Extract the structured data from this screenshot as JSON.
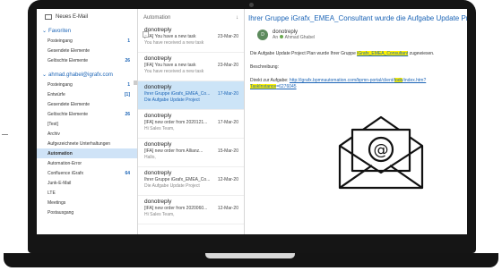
{
  "folders": {
    "new_mail": "Neues E-Mail",
    "favorites_label": "Favoriten",
    "favorites": [
      {
        "label": "Posteingang",
        "count": "1"
      },
      {
        "label": "Gesendete Elemente",
        "count": ""
      },
      {
        "label": "Gelöschte Elemente",
        "count": "26"
      }
    ],
    "account": "ahmad.ghabel@igrafx.com",
    "account_items": [
      {
        "label": "Posteingang",
        "count": "1",
        "selected": false
      },
      {
        "label": "Entwürfe",
        "count": "[1]",
        "selected": false
      },
      {
        "label": "Gesendete Elemente",
        "count": "",
        "selected": false
      },
      {
        "label": "Gelöschte Elemente",
        "count": "26",
        "selected": false
      },
      {
        "label": "[Test]",
        "count": "",
        "selected": false
      },
      {
        "label": "Archiv",
        "count": "",
        "selected": false
      },
      {
        "label": "Aufgezeichnete Unterhaltungen",
        "count": "",
        "selected": false
      },
      {
        "label": "Automation",
        "count": "",
        "selected": true
      },
      {
        "label": "Automation-Error",
        "count": "",
        "selected": false
      },
      {
        "label": "Confluence iGrafx",
        "count": "64",
        "selected": false
      },
      {
        "label": "Junk-E-Mail",
        "count": "",
        "selected": false
      },
      {
        "label": "LTE",
        "count": "",
        "selected": false
      },
      {
        "label": "Meetings",
        "count": "",
        "selected": false
      },
      {
        "label": "Postausgang",
        "count": "",
        "selected": false
      }
    ]
  },
  "msglist": {
    "title": "Automation",
    "sort": "↓",
    "messages": [
      {
        "from": "donotreply",
        "subject": "[IFA] You have a new task",
        "date": "23-Mar-20",
        "preview": "You have received a new task",
        "selected": false
      },
      {
        "from": "donotreply",
        "subject": "[IFA] You have a new task",
        "date": "23-Mar-20",
        "preview": "You have received a new task",
        "selected": false
      },
      {
        "from": "donotreply",
        "subject": "Ihrer Gruppe iGrafx_EMEA_Co...",
        "date": "17-Mar-20",
        "preview": "Die Aufgabe Update Project",
        "selected": true
      },
      {
        "from": "donotreply",
        "subject": "[IFA] new order from 2020121...",
        "date": "17-Mar-20",
        "preview": "Hi Sales Team,",
        "selected": false
      },
      {
        "from": "donotreply",
        "subject": "[IFA] new order from Allianz...",
        "date": "15-Mar-20",
        "preview": "Hallo,",
        "selected": false
      },
      {
        "from": "donotreply",
        "subject": "Ihrer Gruppe iGrafx_EMEA_Co...",
        "date": "12-Mar-20",
        "preview": "Die Aufgabe Update Project",
        "selected": false
      },
      {
        "from": "donotreply",
        "subject": "[IFA] new order from 2020060...",
        "date": "12-Mar-20",
        "preview": "Hi Sales Team,",
        "selected": false
      }
    ]
  },
  "reading": {
    "subject": "Ihrer Gruppe iGrafx_EMEA_Consultant wurde die Aufgabe Update Project Plan im Prozess",
    "avatar_initial": "D",
    "sender": "donotreply",
    "to_prefix": "An",
    "to": "Ahmad Ghabel",
    "body_line1_a": "Die Aufgabe Update Project Plan wurde Ihrer Gruppe ",
    "body_line1_hl": "iGrafx_EMEA_Consultant",
    "body_line1_b": " zugewiesen.",
    "beschreibung": "Beschreibung:",
    "direkt_label": "Direkt zur Aufgabe: ",
    "link_a": "http://igrafx.bpmnautomation.com/bpmn-portal/client/",
    "link_hl1": "todo",
    "link_b": "/index.htm?",
    "link_hl2": "TaskInstance",
    "link_c": "=6276045"
  },
  "colors": {
    "accent": "#1b64b6",
    "highlight": "#fff200",
    "selected_row": "#cce4f7"
  },
  "icons": [
    "new-mail-icon",
    "envelope-at-icon",
    "pin-icon"
  ]
}
